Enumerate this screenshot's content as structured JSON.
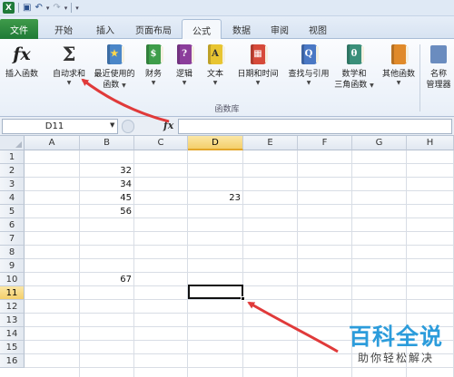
{
  "quick_access": {
    "app_letter": "X"
  },
  "tabs": [
    {
      "label": "文件"
    },
    {
      "label": "开始"
    },
    {
      "label": "插入"
    },
    {
      "label": "页面布局"
    },
    {
      "label": "公式"
    },
    {
      "label": "数据"
    },
    {
      "label": "审阅"
    },
    {
      "label": "视图"
    }
  ],
  "active_tab": "公式",
  "ribbon": {
    "insert_function": "插入函数",
    "autosum": "自动求和",
    "recent_l1": "最近使用的",
    "recent_l2": "函数",
    "financial": "财务",
    "logical": "逻辑",
    "text": "文本",
    "datetime": "日期和时间",
    "lookup": "查找与引用",
    "math_l1": "数学和",
    "math_l2": "三角函数",
    "other": "其他函数",
    "namemgr_l1": "名称",
    "namemgr_l2": "管理器",
    "group_label": "函数库",
    "book_glyphs": {
      "financial": "$",
      "logical": "?",
      "text": "A",
      "datetime": "▦",
      "lookup": "Q",
      "math": "θ",
      "other": ""
    }
  },
  "formula_bar": {
    "name_box": "D11",
    "fx": "fx",
    "formula": ""
  },
  "grid": {
    "columns": [
      "A",
      "B",
      "C",
      "D",
      "E",
      "F",
      "G",
      "H"
    ],
    "rows": [
      "1",
      "2",
      "3",
      "4",
      "5",
      "6",
      "7",
      "8",
      "9",
      "10",
      "11",
      "12",
      "13",
      "14",
      "15",
      "16"
    ],
    "selected_column": "D",
    "selected_row": "11",
    "active_cell": "D11",
    "cells": {
      "B2": "32",
      "B3": "34",
      "B4": "45",
      "B5": "56",
      "B10": "67",
      "D4": "23"
    }
  },
  "colors": {
    "file_tab": "#1f7a36",
    "selection_header": "#f4cf6b",
    "arrow": "#e03a3a",
    "watermark": "#2c9cdb"
  },
  "watermark": {
    "main": "百科全说",
    "sub": "助你轻松解决"
  }
}
